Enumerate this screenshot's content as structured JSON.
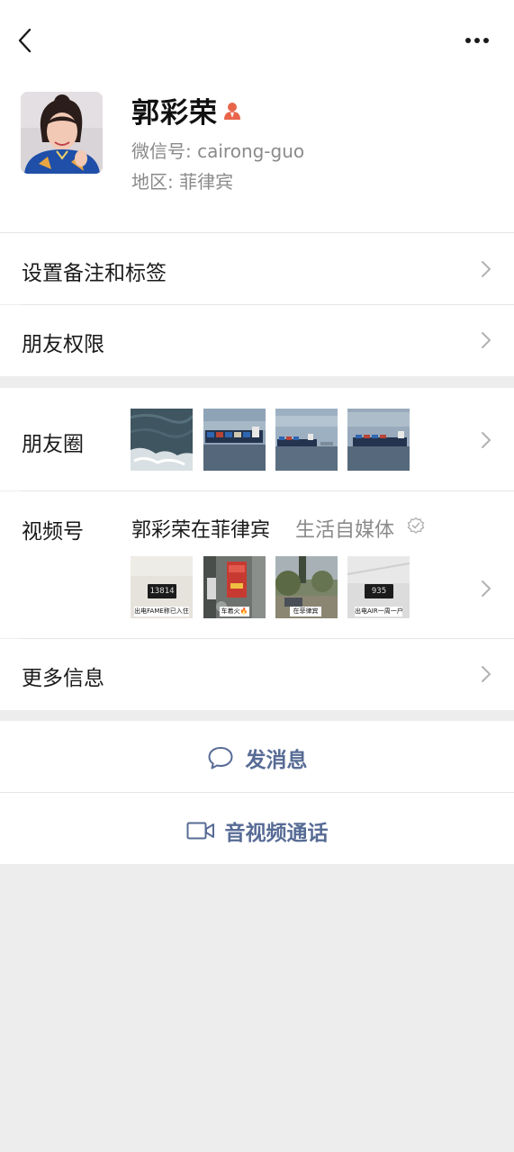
{
  "header": {
    "back_icon": "chevron-left-icon",
    "more_icon": "more-horizontal-icon"
  },
  "profile": {
    "name": "郭彩荣",
    "badge_icon": "person-badge-icon",
    "badge_color": "#e8654a",
    "wechat_id_label": "微信号:",
    "wechat_id": "cairong-guo",
    "region_label": "地区:",
    "region": "菲律宾"
  },
  "settings": {
    "remarks_tags": "设置备注和标签",
    "friend_permissions": "朋友权限"
  },
  "moments": {
    "label": "朋友圈"
  },
  "channels": {
    "label": "视频号",
    "account_name": "郭彩荣在菲律宾",
    "category": "生活自媒体",
    "verified_icon": "verified-check-icon",
    "thumbnails": [
      {
        "caption": "出电FAME称已入住",
        "counter": "13814"
      },
      {
        "caption": "车着火🔥",
        "counter": ""
      },
      {
        "caption": "在菲律宾",
        "counter": ""
      },
      {
        "caption": "出电AIR一周一户",
        "counter": "935"
      }
    ]
  },
  "more_info": {
    "label": "更多信息"
  },
  "actions": {
    "send_message": "发消息",
    "message_icon": "chat-bubble-icon",
    "av_call": "音视频通话",
    "video_icon": "video-camera-icon"
  },
  "colors": {
    "link_blue": "#576b95",
    "background": "#ededed"
  }
}
